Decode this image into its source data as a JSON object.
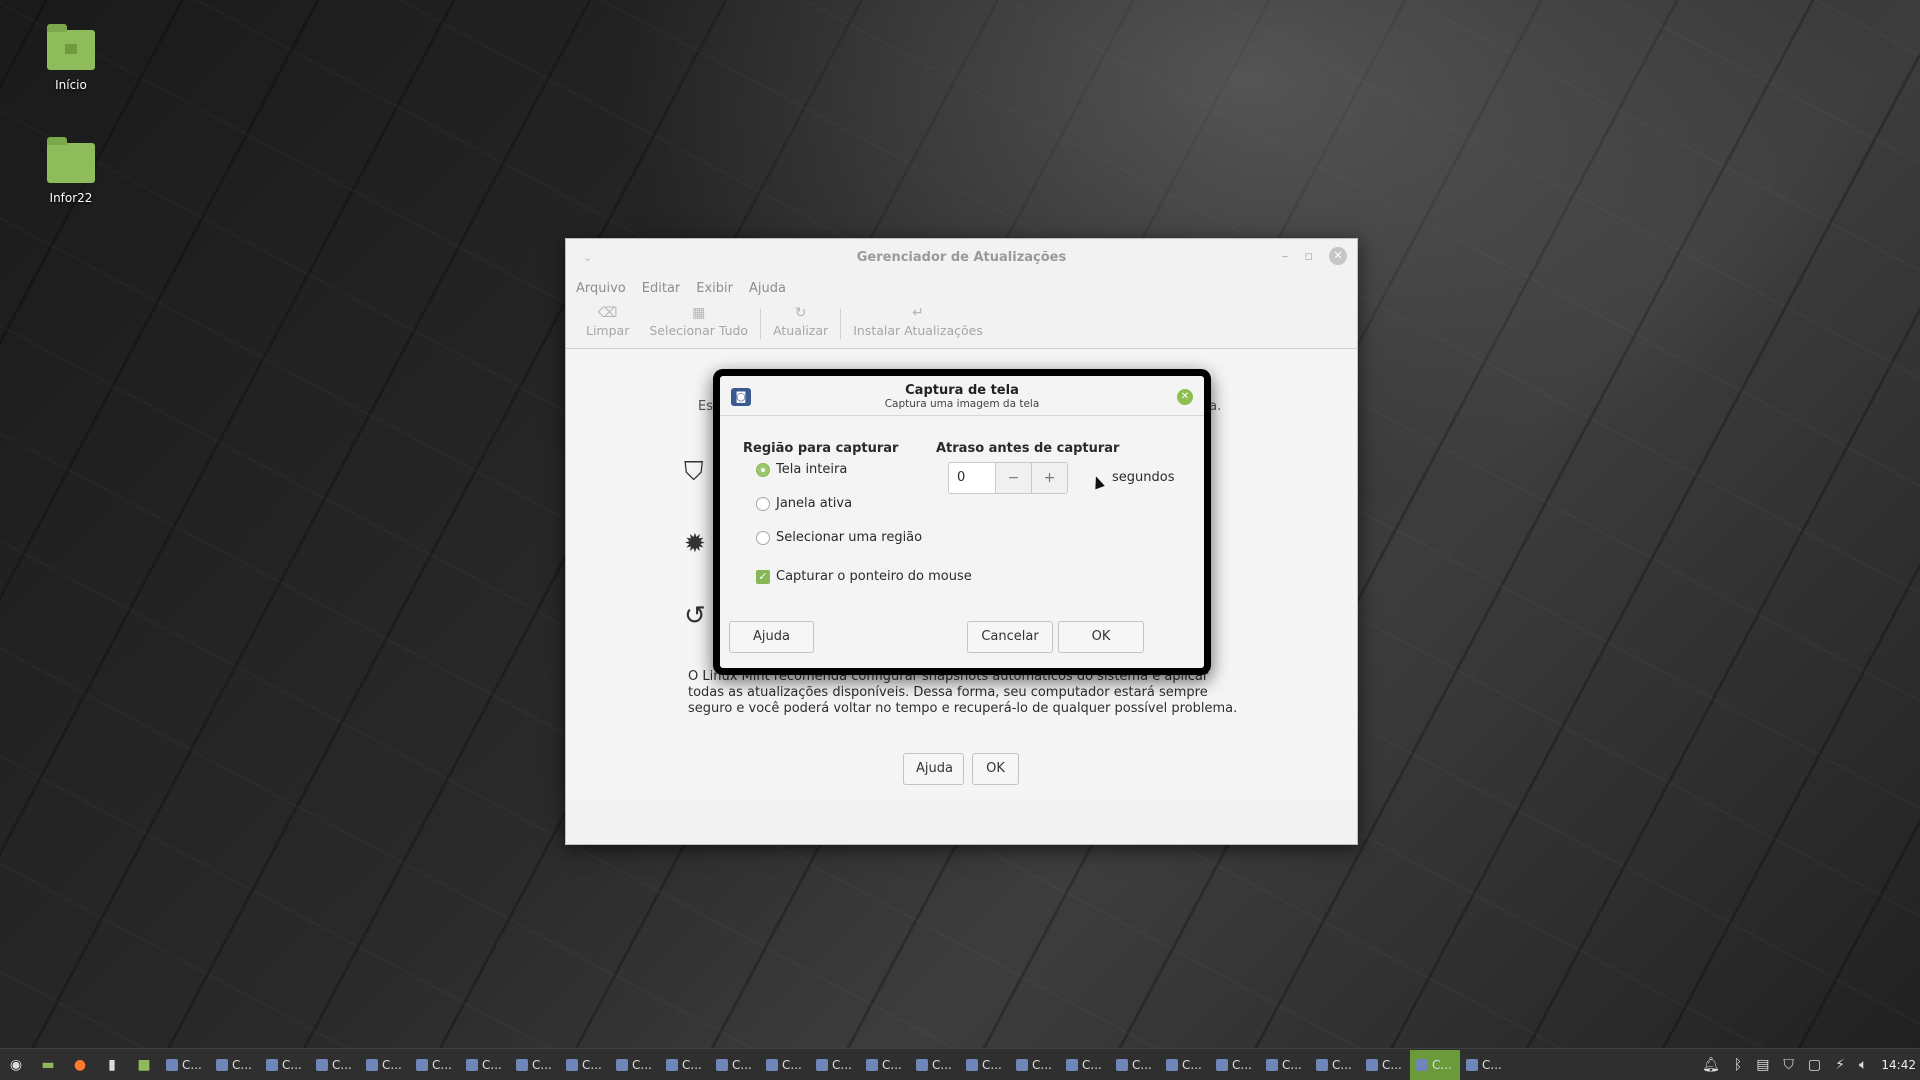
{
  "desktop": {
    "icons": [
      {
        "label": "Início"
      },
      {
        "label": "Infor22"
      }
    ]
  },
  "update_manager": {
    "title": "Gerenciador de Atualizações",
    "menu": [
      "Arquivo",
      "Editar",
      "Exibir",
      "Ajuda"
    ],
    "toolbar": {
      "clear": "Limpar",
      "select_all": "Selecionar Tudo",
      "refresh": "Atualizar",
      "install": "Instalar Atualizações"
    },
    "partial_left": "Es",
    "partial_right": "ça.",
    "description": "O Linux Mint recomenda configurar snapshots automáticos do sistema e aplicar todas as atualizações disponíveis. Dessa forma, seu computador estará sempre seguro e você poderá voltar no tempo e recuperá-lo de qualquer possível problema.",
    "help_button": "Ajuda",
    "ok_button": "OK"
  },
  "screenshot_dialog": {
    "title": "Captura de tela",
    "subtitle": "Captura uma imagem da tela",
    "region_title": "Região para capturar",
    "options": [
      {
        "label": "Tela inteira",
        "selected": true
      },
      {
        "label": "Janela ativa",
        "selected": false
      },
      {
        "label": "Selecionar uma região",
        "selected": false
      }
    ],
    "capture_pointer": {
      "label": "Capturar o ponteiro do mouse",
      "checked": true
    },
    "delay_title": "Atraso antes de capturar",
    "delay_value": "0",
    "minus": "−",
    "plus": "+",
    "delay_unit": "segundos",
    "help_button": "Ajuda",
    "cancel_button": "Cancelar",
    "ok_button": "OK"
  },
  "taskbar": {
    "task_label": "C...",
    "clock": "14:42"
  },
  "colors": {
    "accent": "#87b858",
    "taskbar": "#2f2f2f"
  }
}
